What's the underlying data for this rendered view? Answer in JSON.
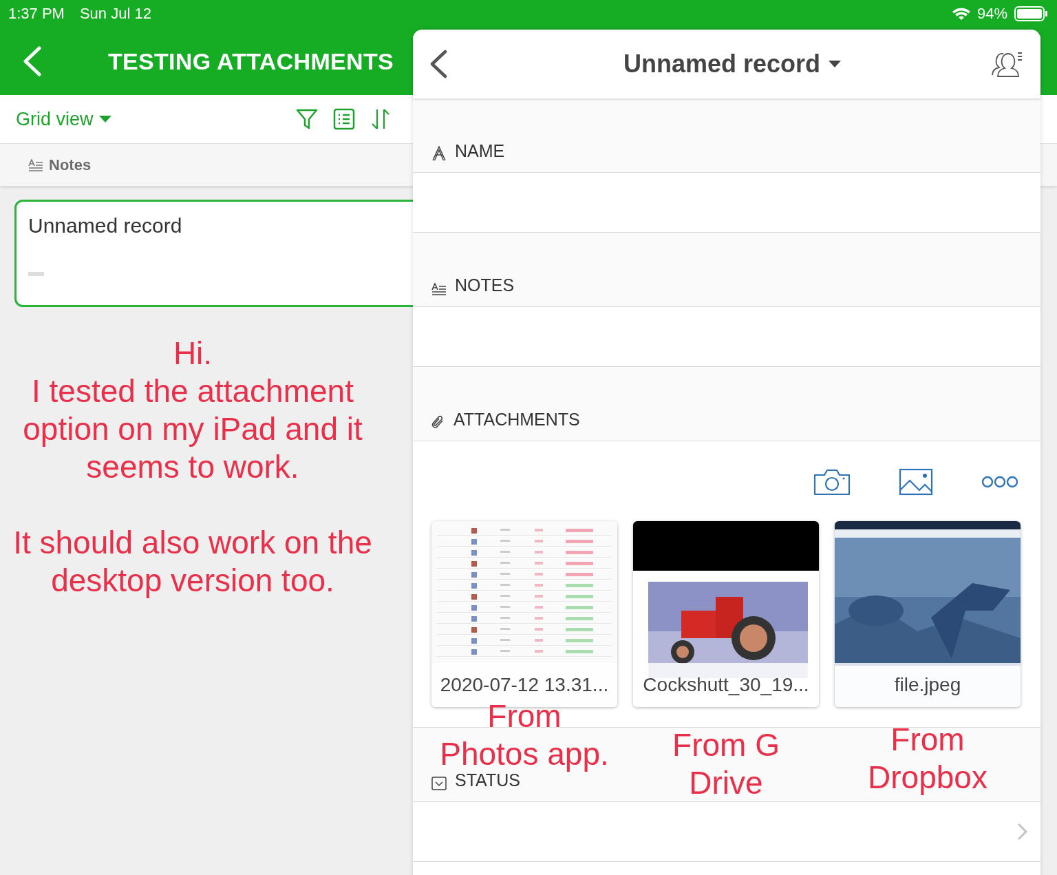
{
  "status_bar": {
    "time": "1:37 PM",
    "date": "Sun Jul 12",
    "battery": "94%"
  },
  "app": {
    "title": "TESTING ATTACHMENTS",
    "view_label": "Grid view",
    "column_header": "Notes",
    "record_card": {
      "title": "Unnamed record"
    }
  },
  "annotations": [
    {
      "text": "Hi."
    },
    {
      "text": "I tested the attachment option on my iPad and it seems to work."
    },
    {
      "text": "It should also work on the desktop version too."
    }
  ],
  "record_panel": {
    "title": "Unnamed record",
    "fields": [
      {
        "kind": "text",
        "label": "NAME"
      },
      {
        "kind": "notes",
        "label": "NOTES"
      },
      {
        "kind": "attachments",
        "label": "ATTACHMENTS",
        "attachments": [
          {
            "name": "2020-07-12 13.31...",
            "kind": "picture",
            "note": "From Photos app."
          },
          {
            "name": "Cockshutt_30_19...",
            "kind": "picture",
            "note": "From G Drive"
          },
          {
            "name": "file.jpeg",
            "kind": "picture",
            "note": "From Dropbox"
          }
        ]
      },
      {
        "kind": "select",
        "label": "STATUS"
      }
    ]
  }
}
